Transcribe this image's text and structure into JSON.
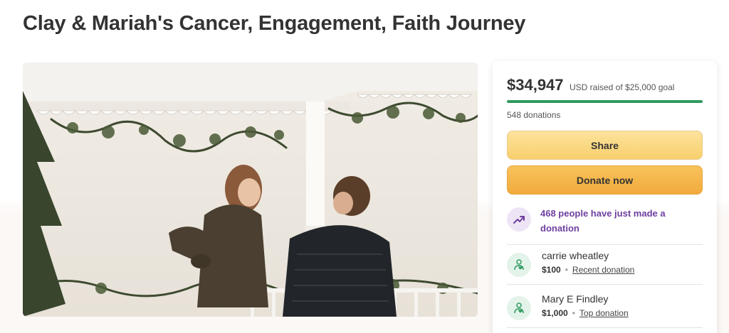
{
  "page": {
    "title": "Clay & Mariah's Cancer, Engagement, Faith Journey"
  },
  "hero": {
    "alt": "Couple engagement photo on a snowy porch decorated with garland"
  },
  "fundraiser": {
    "raised_amount": "$34,947",
    "raised_text": "USD raised of $25,000 goal",
    "progress_fraction": 1.0,
    "donation_count": "548 donations",
    "share_label": "Share",
    "donate_label": "Donate now",
    "trend_text": "468 people have just made a donation",
    "colors": {
      "progress": "#2f9a5f",
      "trend": "#6e3fa0",
      "donate": "#f1aa3c",
      "share": "#f8cf6d"
    }
  },
  "donors": [
    {
      "name": "carrie wheatley",
      "amount": "$100",
      "tag": "Recent donation"
    },
    {
      "name": "Mary E Findley",
      "amount": "$1,000",
      "tag": "Top donation"
    }
  ]
}
